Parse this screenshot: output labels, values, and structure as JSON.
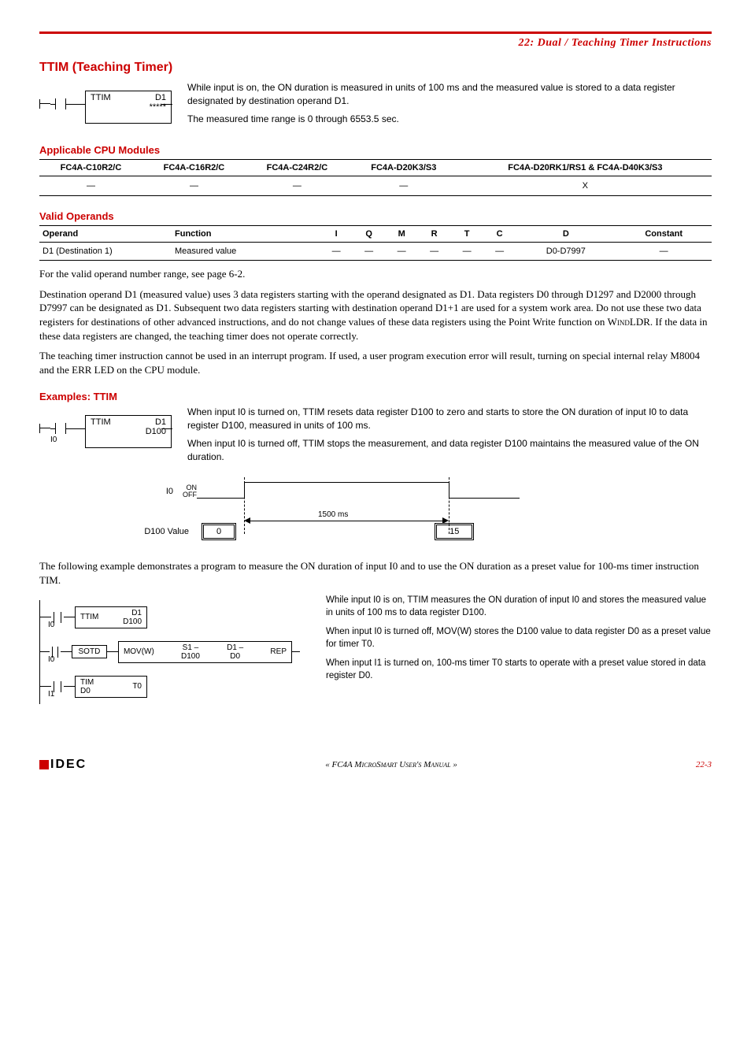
{
  "chapter_header": "22: Dual / Teaching Timer Instructions",
  "section_title": "TTIM (Teaching Timer)",
  "ttim_block": {
    "name": "TTIM",
    "d": "D1",
    "stars": "*****"
  },
  "intro": {
    "p1": "While input is on, the ON duration is measured in units of 100 ms and the measured value is stored to a data register designated by destination operand D1.",
    "p2": "The measured time range is 0 through 6553.5 sec."
  },
  "applicable_heading": "Applicable CPU Modules",
  "cpu_table": {
    "headers": [
      "FC4A-C10R2/C",
      "FC4A-C16R2/C",
      "FC4A-C24R2/C",
      "FC4A-D20K3/S3",
      "FC4A-D20RK1/RS1 & FC4A-D40K3/S3"
    ],
    "row": [
      "—",
      "—",
      "—",
      "—",
      "X"
    ]
  },
  "valid_heading": "Valid Operands",
  "ops_table": {
    "headers": [
      "Operand",
      "Function",
      "I",
      "Q",
      "M",
      "R",
      "T",
      "C",
      "D",
      "Constant"
    ],
    "row": [
      "D1 (Destination 1)",
      "Measured value",
      "—",
      "—",
      "—",
      "—",
      "—",
      "—",
      "D0-D7997",
      "—"
    ]
  },
  "body": {
    "p1": "For the valid operand number range, see page 6-2.",
    "p2_a": "Destination operand D1 (measured value) uses 3 data registers starting with the operand designated as D1. Data registers D0 through D1297 and D2000 through D7997 can be designated as D1. Subsequent two data registers starting with destination operand D1+1 are used for a system work area. Do not use these two data registers for destinations of other advanced instructions, and do not change values of these data registers using the Point Write function on ",
    "p2_w": "WindLDR",
    "p2_b": ". If the data in these data registers are changed, the teaching timer does not operate correctly.",
    "p3": "The teaching timer instruction cannot be used in an interrupt program. If used, a user program execution error will result, turning on special internal relay M8004 and the ERR LED on the CPU module."
  },
  "examples_heading": "Examples: TTIM",
  "ex1_block": {
    "name": "TTIM",
    "d": "D1",
    "reg": "D100",
    "input": "I0"
  },
  "ex1": {
    "p1": "When input I0 is turned on, TTIM resets data register D100 to zero and starts to store the ON duration of input I0 to data register D100, measured in units of 100 ms.",
    "p2": "When input I0 is turned off, TTIM stops the measurement, and data register D100 maintains the measured value of the ON duration."
  },
  "timing": {
    "i0": "I0",
    "on": "ON",
    "off": "OFF",
    "duration": "1500 ms",
    "d100label": "D100 Value",
    "v0": "0",
    "v15": "15"
  },
  "chart_data": {
    "type": "timing",
    "signal": "I0",
    "low_before": true,
    "high_duration_ms": 1500,
    "low_after": true,
    "d100_before": 0,
    "d100_after": 15
  },
  "ex2_intro": "The following example demonstrates a program to measure the ON duration of input I0 and to use the ON duration as a preset value for 100-ms timer instruction TIM.",
  "ladder": {
    "r1": {
      "in": "I0",
      "box_name": "TTIM",
      "d1": "D1",
      "d1reg": "D100"
    },
    "r2": {
      "in": "I0",
      "sotd": "SOTD",
      "mov": "MOV(W)",
      "s1": "S1 –",
      "s1reg": "D100",
      "d1": "D1 –",
      "d1reg": "D0",
      "rep": "REP"
    },
    "r3": {
      "in": "I1",
      "tim": "TIM",
      "treg": "D0",
      "t0": "T0"
    }
  },
  "ex2": {
    "p1": "While input I0 is on, TTIM measures the ON duration of input I0 and stores the measured value in units of 100 ms to data register D100.",
    "p2": "When input I0 is turned off, MOV(W) stores the D100 value to data register D0 as a preset value for timer T0.",
    "p3": "When input I1 is turned on, 100-ms timer T0 starts to operate with a preset value stored in data register D0."
  },
  "footer": {
    "logo": "IDEC",
    "center": "« FC4A MicroSmart User's Manual »",
    "page": "22-3"
  }
}
